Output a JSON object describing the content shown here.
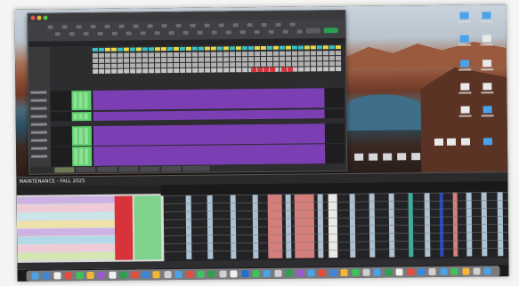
{
  "lower_window": {
    "title": "MAINTENANCE - FALL 2025"
  },
  "colors": {
    "schedule_purple": "#7b3fb3",
    "schedule_green": "#5fcf6f",
    "header_teal": "#38c0c8",
    "header_yellow": "#e8d84a",
    "alert_red": "#d8323a",
    "salmon": "#e88a86",
    "light_blue": "#bcd3e6",
    "accent_green_button": "#2e9e4f"
  }
}
